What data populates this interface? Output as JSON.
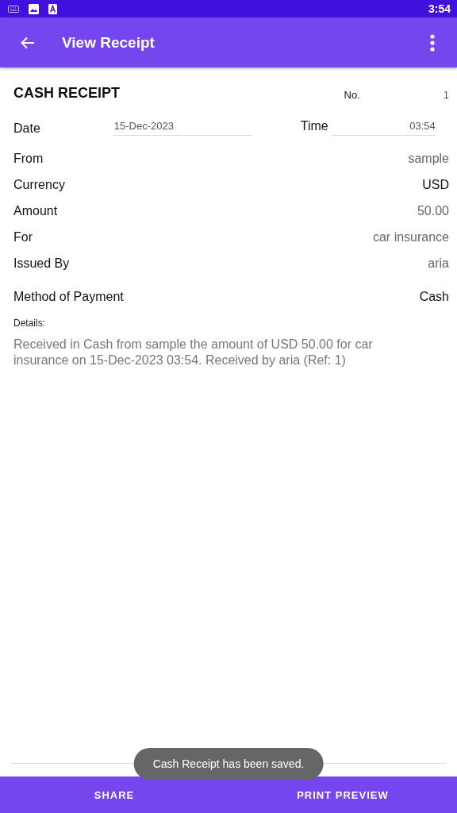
{
  "status_bar": {
    "time": "3:54"
  },
  "app_bar": {
    "title": "View Receipt"
  },
  "receipt": {
    "title": "CASH RECEIPT",
    "number_label": "No.",
    "number": "1",
    "date_label": "Date",
    "date": "15-Dec-2023",
    "time_label": "Time",
    "time": "03:54",
    "fields": [
      {
        "label": "From",
        "value": "sample",
        "kind": "text"
      },
      {
        "label": "Currency",
        "value": "USD",
        "kind": "select"
      },
      {
        "label": "Amount",
        "value": "50.00",
        "kind": "text"
      },
      {
        "label": "For",
        "value": "car insurance",
        "kind": "text"
      },
      {
        "label": "Issued By",
        "value": "aria",
        "kind": "text"
      },
      {
        "label": "Method of Payment",
        "value": "Cash",
        "kind": "select"
      }
    ],
    "details_label": "Details:",
    "details": "Received in Cash from sample the amount of USD 50.00 for car insurance on 15-Dec-2023 03:54. Received by aria (Ref: 1)"
  },
  "toast": "Cash Receipt has been saved.",
  "bottom_buttons": [
    "SHARE",
    "PRINT PREVIEW"
  ]
}
